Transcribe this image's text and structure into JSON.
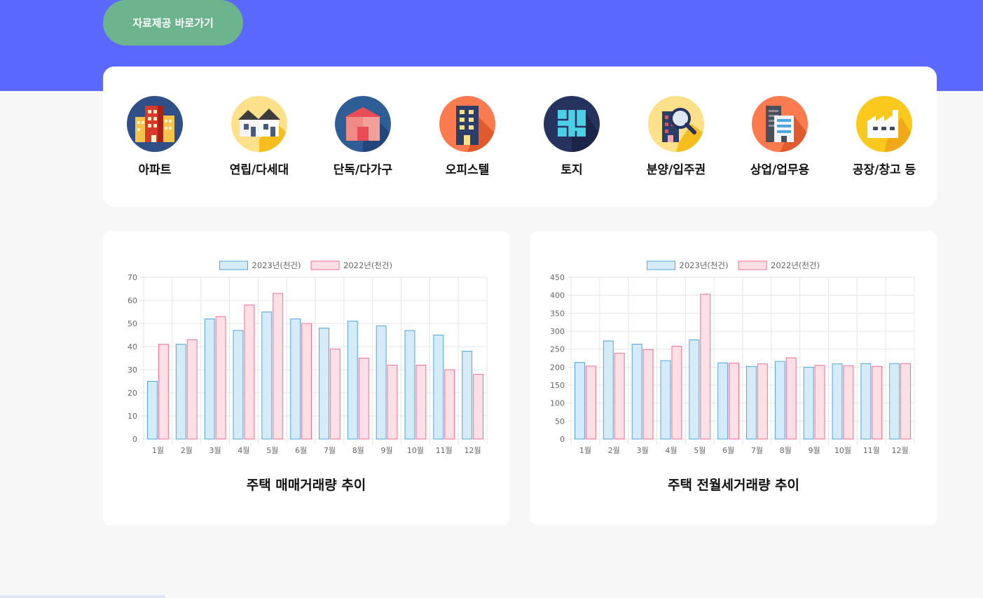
{
  "hero": {
    "button_label": "자료제공 바로가기"
  },
  "categories": [
    {
      "label": "아파트",
      "icon": "apartment-icon",
      "bg": "#2f4f86"
    },
    {
      "label": "연립/다세대",
      "icon": "row-house-icon",
      "bg": "#fde08a"
    },
    {
      "label": "단독/다가구",
      "icon": "detached-house-icon",
      "bg": "#2f5d96"
    },
    {
      "label": "오피스텔",
      "icon": "officetel-icon",
      "bg": "#fa7b4f"
    },
    {
      "label": "토지",
      "icon": "land-map-icon",
      "bg": "#26335f"
    },
    {
      "label": "분양/입주권",
      "icon": "presale-search-icon",
      "bg": "#fde08a"
    },
    {
      "label": "상업/업무용",
      "icon": "commercial-building-icon",
      "bg": "#fa7b4f"
    },
    {
      "label": "공장/창고 등",
      "icon": "factory-icon",
      "bg": "#fbc81e"
    }
  ],
  "colors": {
    "series_2023_fill": "#d5ebf8",
    "series_2023_stroke": "#4ea6dc",
    "series_2022_fill": "#fde0e6",
    "series_2022_stroke": "#f06e8e"
  },
  "chart_data": [
    {
      "type": "bar",
      "caption": "주택 매매거래량 추이",
      "categories": [
        "1월",
        "2월",
        "3월",
        "4월",
        "5월",
        "6월",
        "7월",
        "8월",
        "9월",
        "10월",
        "11월",
        "12월"
      ],
      "series": [
        {
          "name": "2023년(천건)",
          "values": [
            25,
            41,
            52,
            47,
            55,
            52,
            48,
            51,
            49,
            47,
            45,
            38
          ]
        },
        {
          "name": "2022년(천건)",
          "values": [
            41,
            43,
            53,
            58,
            63,
            50,
            39,
            35,
            32,
            32,
            30,
            28
          ]
        }
      ],
      "ylim": [
        0,
        70
      ],
      "yticks": [
        0,
        10,
        20,
        30,
        40,
        50,
        60,
        70
      ],
      "grid": true,
      "legend": "top-center"
    },
    {
      "type": "bar",
      "caption": "주택 전월세거래량 추이",
      "categories": [
        "1월",
        "2월",
        "3월",
        "4월",
        "5월",
        "6월",
        "7월",
        "8월",
        "9월",
        "10월",
        "11월",
        "12월"
      ],
      "series": [
        {
          "name": "2023년(천건)",
          "values": [
            213,
            273,
            264,
            218,
            276,
            212,
            202,
            216,
            200,
            209,
            210,
            210
          ]
        },
        {
          "name": "2022년(천건)",
          "values": [
            203,
            239,
            249,
            258,
            403,
            211,
            209,
            226,
            205,
            204,
            202,
            210
          ]
        }
      ],
      "ylim": [
        0,
        450
      ],
      "yticks": [
        0,
        50,
        100,
        150,
        200,
        250,
        300,
        350,
        400,
        450
      ],
      "grid": true,
      "legend": "top-center"
    }
  ]
}
